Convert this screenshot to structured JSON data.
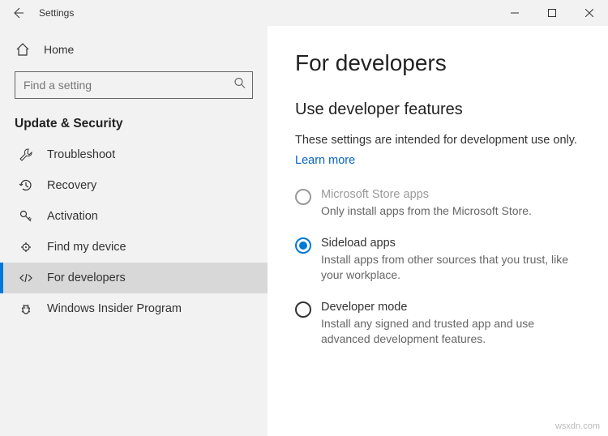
{
  "titlebar": {
    "title": "Settings"
  },
  "sidebar": {
    "home_label": "Home",
    "search_placeholder": "Find a setting",
    "section_header": "Update & Security",
    "items": [
      {
        "label": "Troubleshoot"
      },
      {
        "label": "Recovery"
      },
      {
        "label": "Activation"
      },
      {
        "label": "Find my device"
      },
      {
        "label": "For developers"
      },
      {
        "label": "Windows Insider Program"
      }
    ]
  },
  "main": {
    "heading": "For developers",
    "subheading": "Use developer features",
    "desc": "These settings are intended for development use only.",
    "learn_more": "Learn more",
    "options": [
      {
        "title": "Microsoft Store apps",
        "desc": "Only install apps from the Microsoft Store."
      },
      {
        "title": "Sideload apps",
        "desc": "Install apps from other sources that you trust, like your workplace."
      },
      {
        "title": "Developer mode",
        "desc": "Install any signed and trusted app and use advanced development features."
      }
    ]
  },
  "watermark": "wsxdn.com"
}
